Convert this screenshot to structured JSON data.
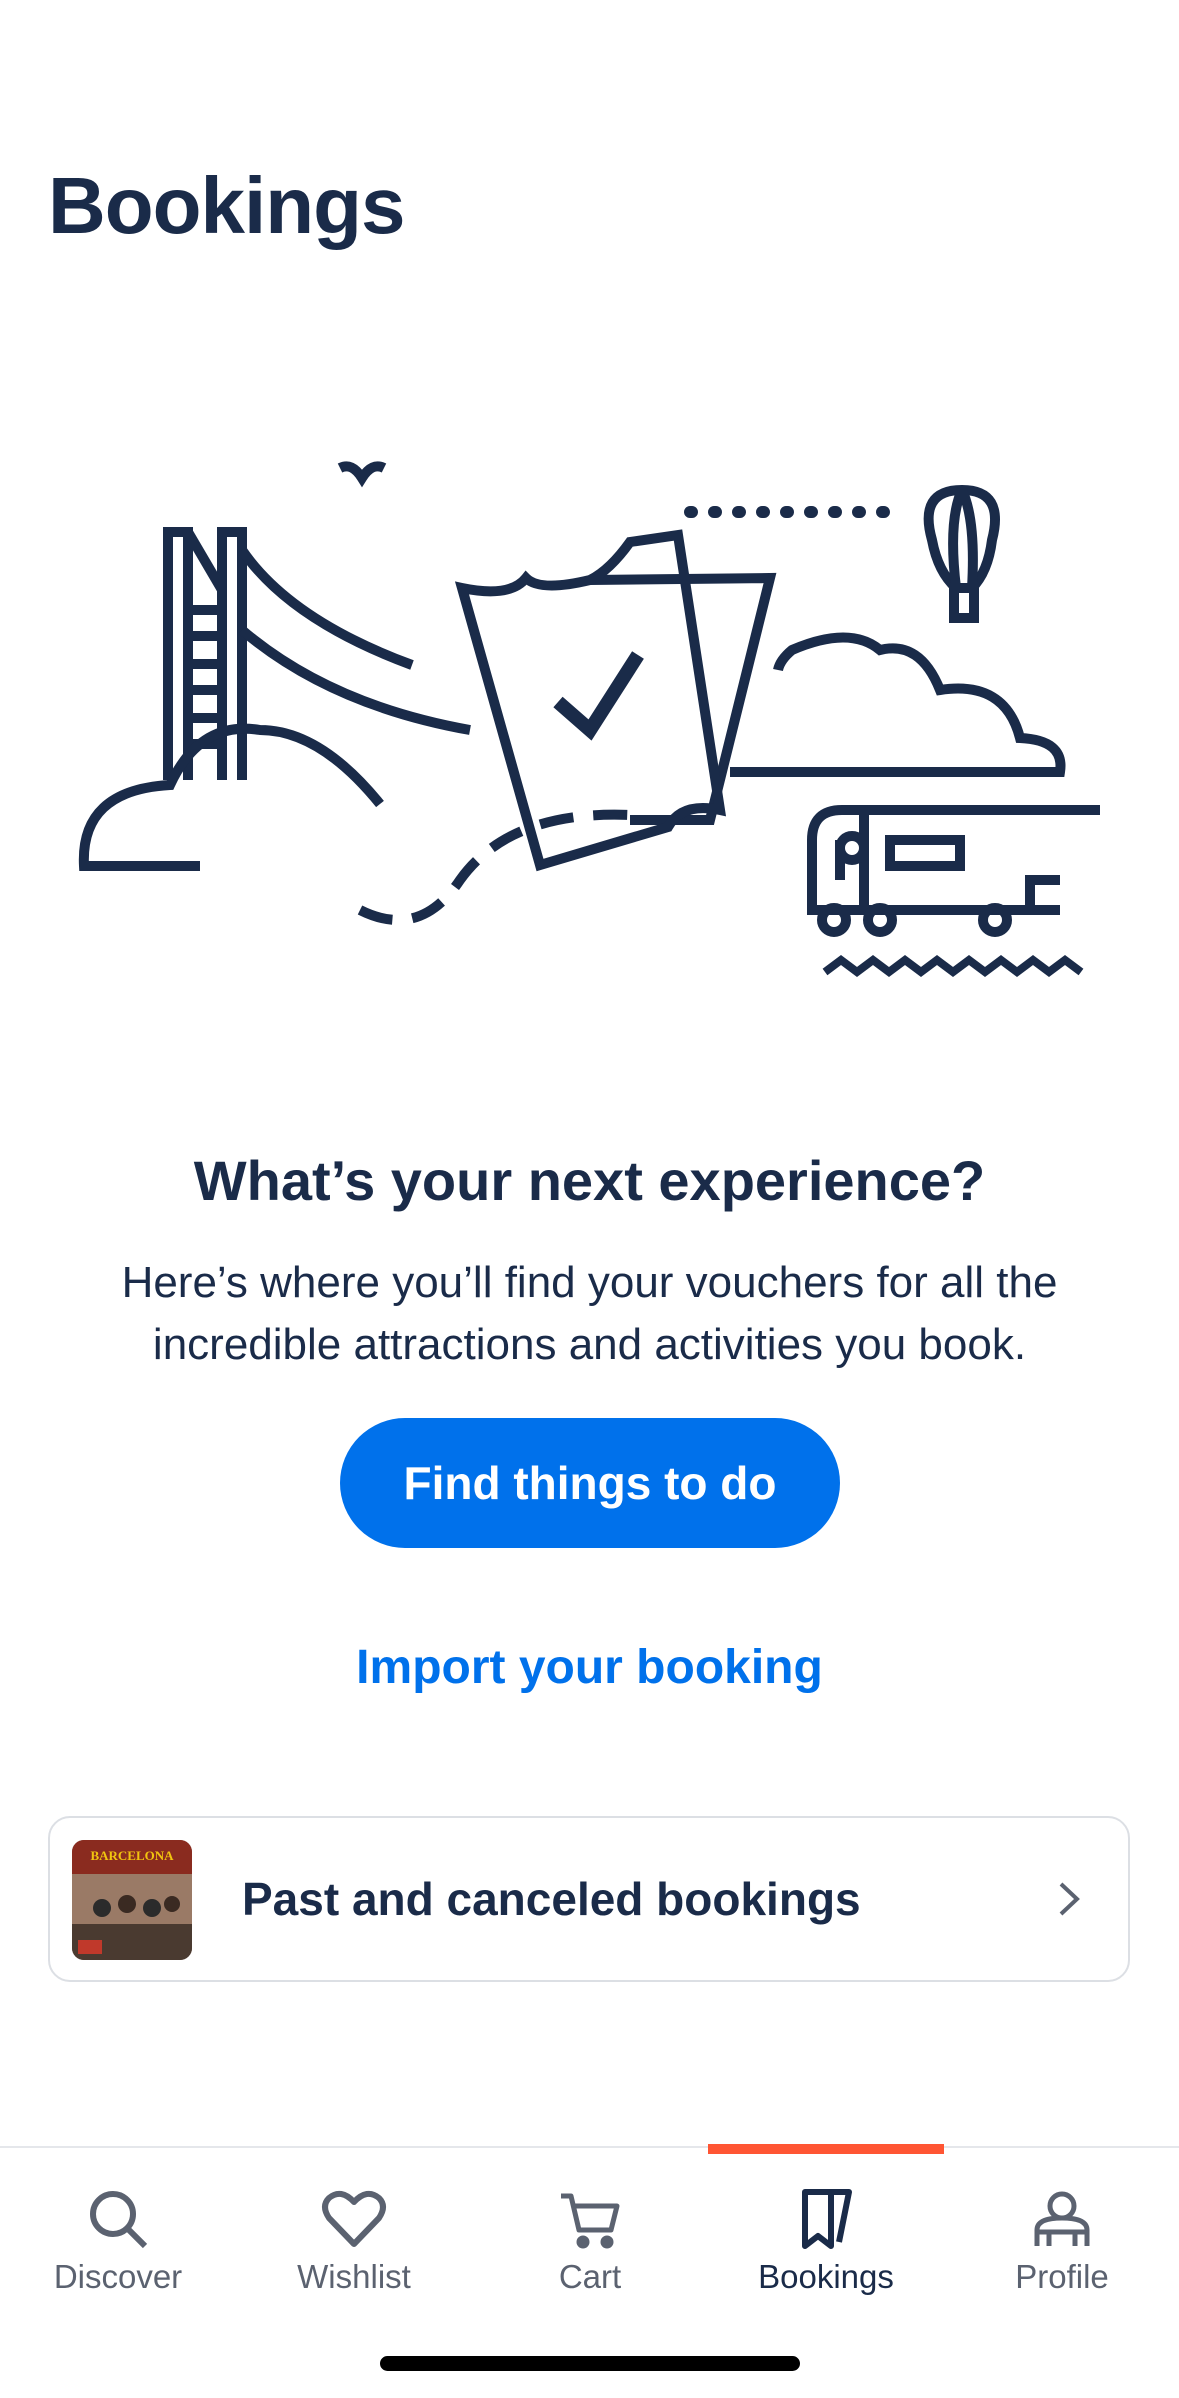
{
  "page": {
    "title": "Bookings"
  },
  "empty_state": {
    "heading": "What’s your next experience?",
    "description": "Here’s where you’ll find your vouchers for all the incredible attractions and activities you book.",
    "cta_label": "Find things to do",
    "import_label": "Import your booking"
  },
  "past_bookings": {
    "label": "Past and canceled bookings",
    "thumbnail_text": "BARCELONA"
  },
  "tabbar": {
    "active": "bookings",
    "tabs": [
      {
        "id": "discover",
        "label": "Discover",
        "icon": "search-icon"
      },
      {
        "id": "wishlist",
        "label": "Wishlist",
        "icon": "heart-icon"
      },
      {
        "id": "cart",
        "label": "Cart",
        "icon": "cart-icon"
      },
      {
        "id": "bookings",
        "label": "Bookings",
        "icon": "tickets-icon"
      },
      {
        "id": "profile",
        "label": "Profile",
        "icon": "profile-icon"
      }
    ]
  },
  "colors": {
    "primary": "#0071eb",
    "text": "#1a2b49",
    "accent": "#ff5533",
    "muted": "#5b6270"
  }
}
